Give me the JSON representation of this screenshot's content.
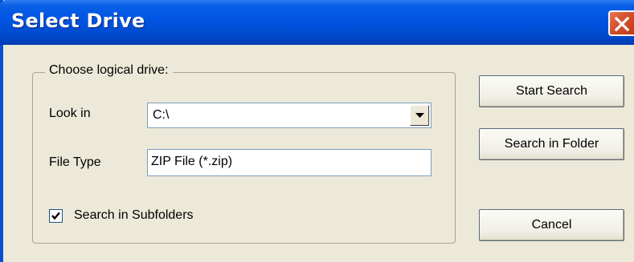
{
  "window": {
    "title": "Select Drive",
    "close_icon": "close-icon",
    "title_bar_color": "#0054e3",
    "close_button_color": "#d4502c"
  },
  "group": {
    "legend": "Choose logical drive:"
  },
  "look_in": {
    "label": "Look in",
    "value": "C:\\",
    "dropdown_icon": "chevron-down-icon"
  },
  "file_type": {
    "label": "File Type",
    "value": "ZIP File (*.zip)"
  },
  "subfolders": {
    "label": "Search in Subfolders",
    "checked": true,
    "check_icon": "checkmark-icon"
  },
  "buttons": {
    "start_search": "Start Search",
    "search_in_folder": "Search in Folder",
    "cancel": "Cancel"
  }
}
